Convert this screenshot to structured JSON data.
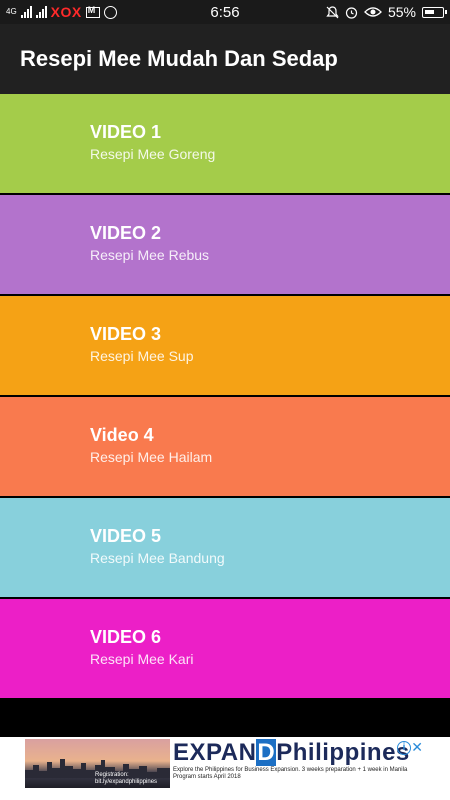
{
  "status_bar": {
    "network_label": "4G",
    "carrier": "XOX",
    "time": "6:56",
    "battery": "55%"
  },
  "app_bar": {
    "title": "Resepi Mee Mudah Dan Sedap"
  },
  "videos": [
    {
      "title": "VIDEO 1",
      "subtitle": "Resepi Mee Goreng",
      "color": "#a4cc4a"
    },
    {
      "title": "VIDEO 2",
      "subtitle": "Resepi Mee Rebus",
      "color": "#b373cc"
    },
    {
      "title": "VIDEO 3",
      "subtitle": "Resepi Mee Sup",
      "color": "#f5a215"
    },
    {
      "title": "Video 4",
      "subtitle": "Resepi Mee Hailam",
      "color": "#f97a4e"
    },
    {
      "title": "VIDEO 5",
      "subtitle": "Resepi Mee Bandung",
      "color": "#88d0dc"
    },
    {
      "title": "VIDEO 6",
      "subtitle": "Resepi Mee Kari",
      "color": "#ec1fc7"
    }
  ],
  "ad": {
    "brand_prefix": "EXPAN",
    "brand_d": "D",
    "brand_suffix": "Philippines",
    "registration": "Registration:",
    "registration_link": "bit.ly/expandphilippines",
    "copy_line1": "Explore the Philippines for Business Expansion. 3 weeks preparation + 1 week in Manila",
    "copy_line2": "Program starts April 2018"
  }
}
